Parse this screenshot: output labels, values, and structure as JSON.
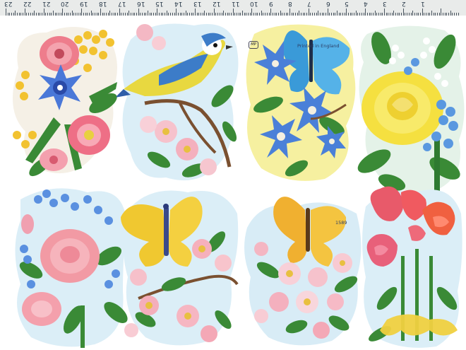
{
  "ruler": {
    "labels": [
      "23",
      "22",
      "21",
      "20",
      "19",
      "18",
      "17",
      "16",
      "15",
      "14",
      "13",
      "12",
      "11",
      "10",
      "9",
      "8",
      "7",
      "6",
      "5",
      "4",
      "3",
      "2",
      "1"
    ]
  },
  "sheet": {
    "printed_text": "Printed in England",
    "number": "1589",
    "logo_text": "MP"
  },
  "colors": {
    "blue_tit_yellow": "#e8d840",
    "blue_tit_blue": "#3c7cc8",
    "butterfly_blue": "#3a9ad8",
    "butterfly_yellow": "#f0c830",
    "rose_pink": "#f08aa0",
    "rose_yellow": "#f5e040",
    "carnation_red": "#e85a5a",
    "leaf_green": "#2f8a3a",
    "backing_blue": "#d8ecf6"
  },
  "motifs": [
    {
      "icon": "flower-bouquet-pink-blue"
    },
    {
      "icon": "blue-tit-bird-with-blossom"
    },
    {
      "icon": "blue-butterfly-with-clematis"
    },
    {
      "icon": "yellow-rose-with-forget-me-nots"
    },
    {
      "icon": "pink-rose-with-forget-me-nots"
    },
    {
      "icon": "yellow-butterfly-with-blossom"
    },
    {
      "icon": "yellow-butterfly-with-apple-blossom"
    },
    {
      "icon": "carnation-bouquet-with-ribbon"
    }
  ]
}
